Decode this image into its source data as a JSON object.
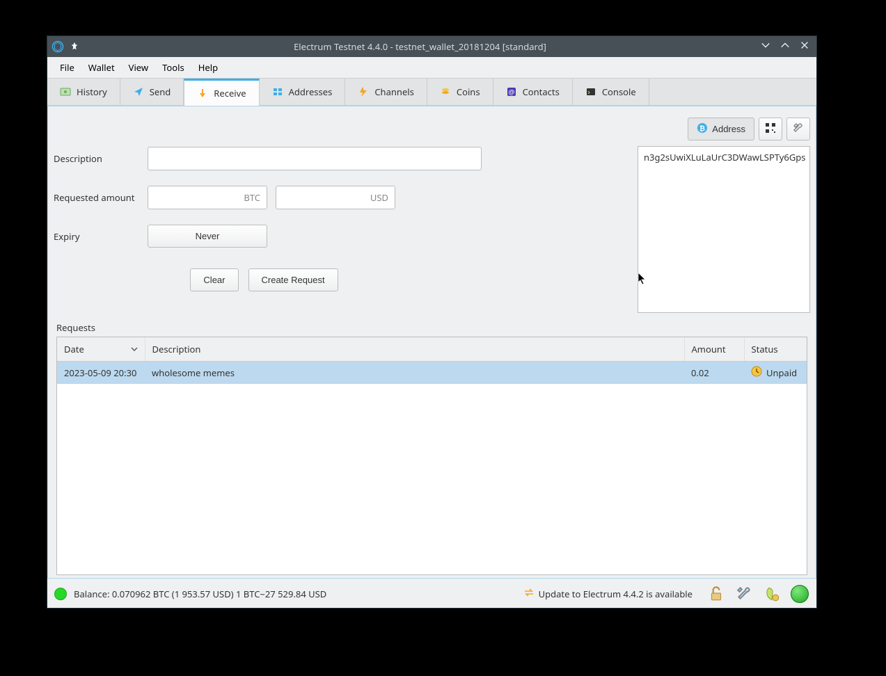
{
  "titlebar": {
    "title": "Electrum Testnet 4.4.0 - testnet_wallet_20181204 [standard]"
  },
  "menubar": [
    "File",
    "Wallet",
    "View",
    "Tools",
    "Help"
  ],
  "tabs": [
    {
      "label": "History"
    },
    {
      "label": "Send"
    },
    {
      "label": "Receive"
    },
    {
      "label": "Addresses"
    },
    {
      "label": "Channels"
    },
    {
      "label": "Coins"
    },
    {
      "label": "Contacts"
    },
    {
      "label": "Console"
    }
  ],
  "receive": {
    "description_label": "Description",
    "description_value": "",
    "requested_label": "Requested amount",
    "amount_btc": "",
    "amount_usd": "",
    "btc_suffix": "BTC",
    "usd_suffix": "USD",
    "expiry_label": "Expiry",
    "expiry_value": "Never",
    "clear_label": "Clear",
    "create_label": "Create Request",
    "address_btn": "Address",
    "address_value": "n3g2sUwiXLuLaUrC3DWawLSPTy6Gps"
  },
  "requests": {
    "section_label": "Requests",
    "columns": {
      "date": "Date",
      "description": "Description",
      "amount": "Amount",
      "status": "Status"
    },
    "rows": [
      {
        "date": "2023-05-09 20:30",
        "description": "wholesome memes",
        "amount": "0.02",
        "status": "Unpaid"
      }
    ]
  },
  "statusbar": {
    "balance": "Balance: 0.070962 BTC (1 953.57 USD)  1 BTC~27 529.84 USD",
    "update": "Update to Electrum 4.4.2 is available"
  }
}
